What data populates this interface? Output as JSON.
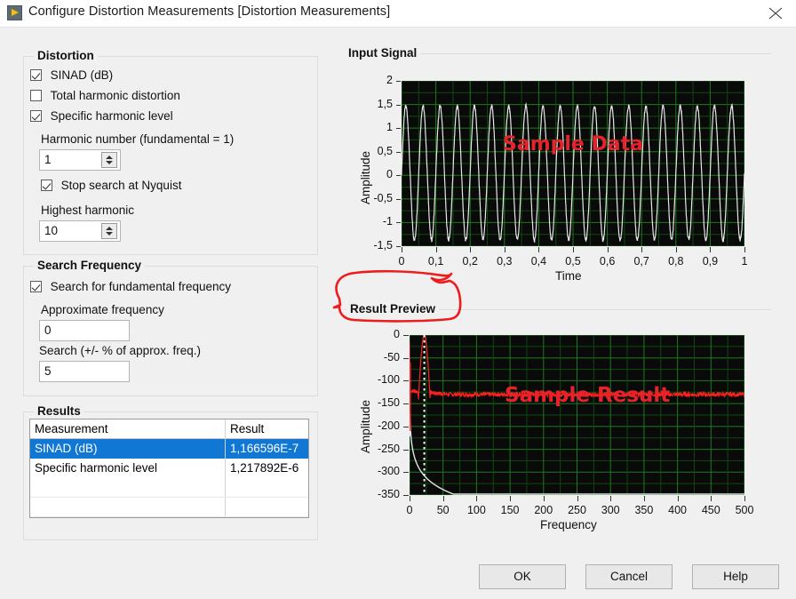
{
  "window": {
    "title": "Configure Distortion Measurements [Distortion Measurements]",
    "icon": "labview-run-icon",
    "close_icon": "close-icon"
  },
  "distortion": {
    "legend": "Distortion",
    "checkboxes": [
      {
        "label": "SINAD (dB)",
        "checked": true
      },
      {
        "label": "Total harmonic distortion",
        "checked": false
      },
      {
        "label": "Specific harmonic level",
        "checked": true
      }
    ],
    "harmonic_number_label": "Harmonic number (fundamental = 1)",
    "harmonic_number_value": "1",
    "stop_search_label": "Stop search at Nyquist",
    "stop_search_checked": true,
    "highest_harmonic_label": "Highest harmonic",
    "highest_harmonic_value": "10"
  },
  "search_frequency": {
    "legend": "Search Frequency",
    "search_fundamental_label": "Search for fundamental frequency",
    "search_fundamental_checked": true,
    "approx_frequency_label": "Approximate frequency",
    "approx_frequency_value": "0",
    "search_percent_label": "Search (+/- % of approx. freq.)",
    "search_percent_value": "5"
  },
  "results": {
    "legend": "Results",
    "columns": [
      "Measurement",
      "Result"
    ],
    "rows": [
      {
        "measurement": "SINAD (dB)",
        "result": "1,166596E-7",
        "selected": true
      },
      {
        "measurement": "Specific harmonic level",
        "result": "1,217892E-6",
        "selected": false
      }
    ],
    "blank_rows": 2,
    "selection_color": "#1077d4"
  },
  "annotation": {
    "shape": "hand-drawn-red-ellipse",
    "color": "#ee1c1c",
    "target": "Result Preview"
  },
  "buttons": [
    {
      "label": "OK",
      "name": "ok-button"
    },
    {
      "label": "Cancel",
      "name": "cancel-button"
    },
    {
      "label": "Help",
      "name": "help-button"
    }
  ],
  "chart_data": [
    {
      "type": "line",
      "name": "input-signal",
      "title": "Input Signal",
      "xlabel": "Time",
      "ylabel": "Amplitude",
      "xlim": [
        0,
        1
      ],
      "ylim": [
        -1.5,
        2
      ],
      "xticks": [
        "0",
        "0,1",
        "0,2",
        "0,3",
        "0,4",
        "0,5",
        "0,6",
        "0,7",
        "0,8",
        "0,9",
        "1"
      ],
      "yticks": [
        "2",
        "1,5",
        "1",
        "0,5",
        "0",
        "-0,5",
        "-1",
        "-1,5"
      ],
      "grid": true,
      "grid_color": "#1e7a1e",
      "plot_bg": "#0a0a0a",
      "trace_color": "#e6e6e6",
      "watermark": "Sample Data",
      "watermark_color": "#e8222a",
      "series": [
        {
          "name": "sine",
          "waveform": "sine",
          "cycles": 20,
          "amplitude": 1.42,
          "offset": 0.05,
          "noise": 0.04
        }
      ]
    },
    {
      "type": "line",
      "name": "result-preview",
      "title": "Result Preview",
      "xlabel": "Frequency",
      "ylabel": "Amplitude",
      "xlim": [
        0,
        500
      ],
      "ylim": [
        -350,
        0
      ],
      "xticks": [
        "0",
        "50",
        "100",
        "150",
        "200",
        "250",
        "300",
        "350",
        "400",
        "450",
        "500"
      ],
      "yticks": [
        "0",
        "-50",
        "-100",
        "-150",
        "-200",
        "-250",
        "-300",
        "-350"
      ],
      "grid": true,
      "grid_color": "#1e7a1e",
      "plot_bg": "#0a0a0a",
      "watermark": "Sample Result",
      "watermark_color": "#e8222a",
      "cursor": {
        "type": "vertical-dotted",
        "x": 22,
        "color": "#ffffff"
      },
      "series": [
        {
          "name": "spectrum",
          "color": "#ff2020",
          "peak_x": 22,
          "peak_y": 0,
          "noise_floor_db": -130,
          "noise_spread_db": 9
        },
        {
          "name": "noise-envelope",
          "color": "#e6e6e6",
          "start_y": -200,
          "end_y": -320,
          "shape": "log-decay"
        }
      ]
    }
  ]
}
